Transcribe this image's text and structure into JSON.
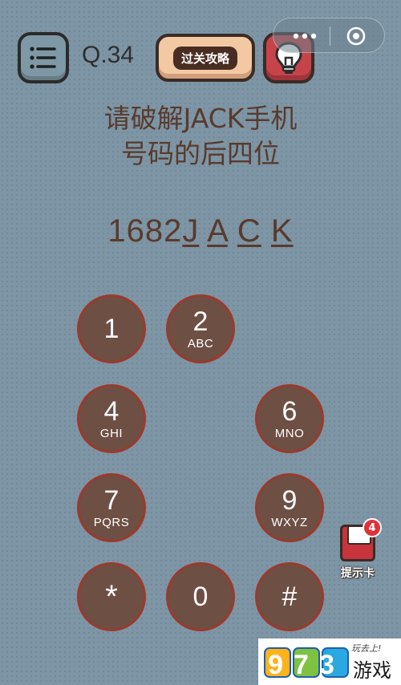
{
  "header": {
    "level": "Q.34",
    "guide_label": "过关攻略"
  },
  "question": {
    "line1": "请破解JACK手机",
    "line2": "号码的后四位"
  },
  "answer": {
    "digits": "1682",
    "letters": [
      "J",
      "A",
      "C",
      "K"
    ]
  },
  "keypad": {
    "k1": {
      "digit": "1",
      "letters": ""
    },
    "k2": {
      "digit": "2",
      "letters": "ABC"
    },
    "k4": {
      "digit": "4",
      "letters": "GHI"
    },
    "k6": {
      "digit": "6",
      "letters": "MNO"
    },
    "k7": {
      "digit": "7",
      "letters": "PQRS"
    },
    "k9": {
      "digit": "9",
      "letters": "WXYZ"
    },
    "kstar": {
      "digit": "*",
      "letters": ""
    },
    "k0": {
      "digit": "0",
      "letters": ""
    },
    "khash": {
      "digit": "#",
      "letters": ""
    }
  },
  "hint_card": {
    "count": "4",
    "label": "提示卡"
  },
  "watermark": {
    "number": "973",
    "slogan": "玩去上!",
    "name": "游戏"
  },
  "colors": {
    "background": "#7d95a5",
    "key_fill": "#6e4f44",
    "key_border": "#9a3a2c",
    "text": "#5a3a2c",
    "hint_red": "#c7434a"
  },
  "icons": {
    "menu": "list-menu-icon",
    "hint": "lightbulb-icon",
    "capsule_more": "more-dots-icon",
    "capsule_close": "target-close-icon"
  }
}
